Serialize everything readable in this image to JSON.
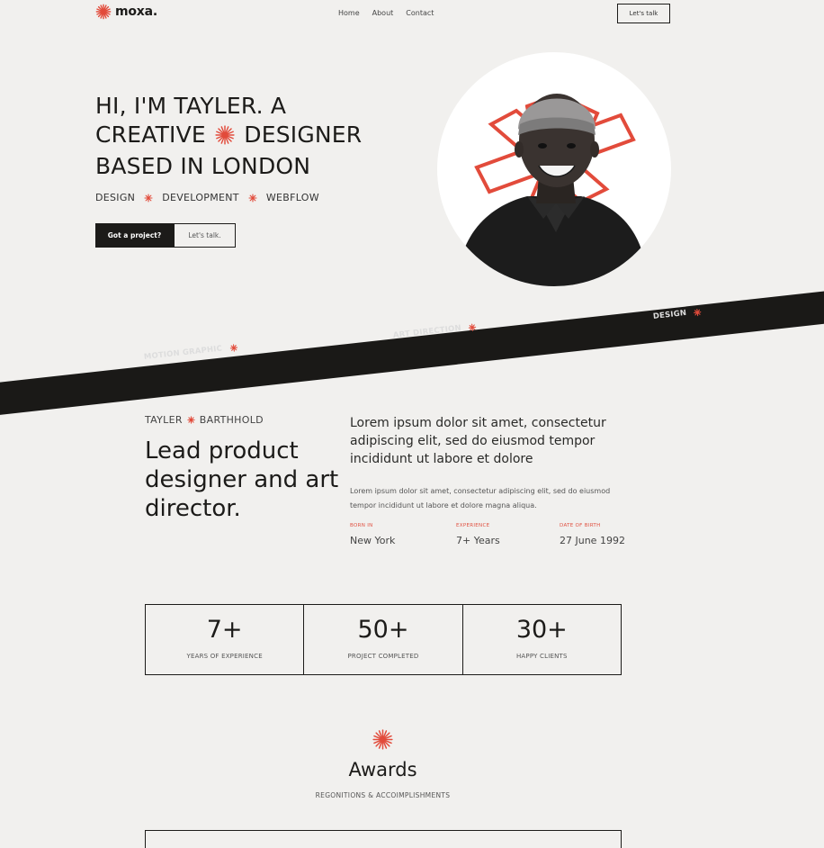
{
  "brand": {
    "name": "moxa.",
    "accent": "#e24b3b",
    "dark": "#1c1b19",
    "background": "#f1f0ee"
  },
  "nav": {
    "items": [
      "Home",
      "About",
      "Contact"
    ],
    "cta": "Let's talk"
  },
  "hero": {
    "title_line1": "HI, I'M TAYLER. A",
    "title_line2_a": "CREATIVE",
    "title_line2_b": "DESIGNER",
    "title_line3": "BASED IN LONDON",
    "services": [
      "DESIGN",
      "DEVELOPMENT",
      "WEBFLOW"
    ],
    "primary_button": "Got a project?",
    "secondary_button": "Let's talk."
  },
  "marquee": {
    "items": [
      "MOTION GRAPHIC",
      "ART DIRECTION",
      "DESIGN"
    ]
  },
  "about": {
    "first_name": "TAYLER",
    "last_name": "BARTHHOLD",
    "headline": "Lead product designer and art director.",
    "intro": "Lorem ipsum dolor sit amet, consectetur adipiscing elit, sed do eiusmod tempor incididunt ut labore et dolore",
    "body": "Lorem ipsum dolor sit amet, consectetur adipiscing elit, sed do eiusmod tempor incididunt ut labore et dolore magna aliqua.",
    "facts": [
      {
        "label": "BORN IN",
        "value": "New York"
      },
      {
        "label": "EXPERIENCE",
        "value": "7+ Years"
      },
      {
        "label": "DATE OF BIRTH",
        "value": "27 June 1992"
      }
    ]
  },
  "stats": [
    {
      "number": "7+",
      "label": "YEARS OF EXPERIENCE"
    },
    {
      "number": "50+",
      "label": "PROJECT COMPLETED"
    },
    {
      "number": "30+",
      "label": "HAPPY CLIENTS"
    }
  ],
  "awards": {
    "title": "Awards",
    "subtitle": "REGONITIONS & ACCOIMPLISHMENTS"
  },
  "icons": {
    "burst": "asterisk-burst-icon"
  }
}
